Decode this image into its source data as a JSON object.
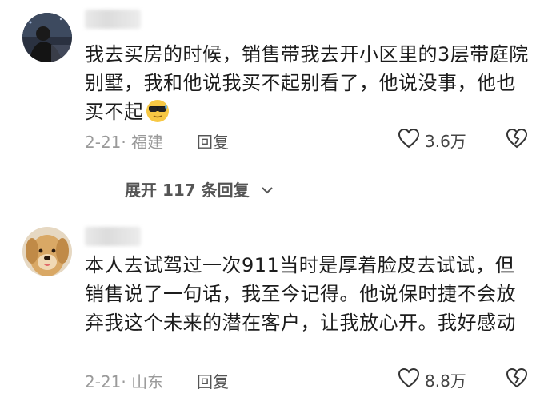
{
  "comments": [
    {
      "text": "我去买房的时候，销售带我去开小区里的3层带庭院别墅，我和他说我买不起别看了，他说没事，他也买不起",
      "emoji": "cool-face-sweat-emoji",
      "date_location": "2-21· 福建",
      "reply_label": "回复",
      "likes": "3.6万"
    },
    {
      "text": "本人去试驾过一次911当时是厚着脸皮去试试，但销售说了一句话，我至今记得。他说保时捷不会放弃我这个未来的潜在客户，让我放心开。我好感动",
      "date_location": "2-21· 山东",
      "reply_label": "回复",
      "likes": "8.8万"
    }
  ],
  "expand_replies": "展开 117 条回复",
  "icons": {
    "like": "heart-outline-icon",
    "dislike": "broken-heart-icon",
    "expand": "chevron-down-icon"
  },
  "colors": {
    "meta_text": "#9a9a9a",
    "body_text": "#1c1c1c"
  }
}
